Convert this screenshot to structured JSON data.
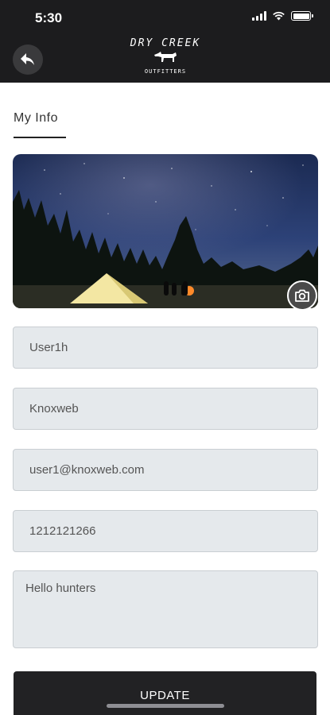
{
  "status_bar": {
    "time": "5:30"
  },
  "header": {
    "logo_top": "DRY CREEK",
    "logo_bottom": "OUTFITTERS"
  },
  "page": {
    "title": "My Info"
  },
  "form": {
    "name": "User1h",
    "company": "Knoxweb",
    "email": "user1@knoxweb.com",
    "phone": "1212121266",
    "bio": "Hello hunters"
  },
  "actions": {
    "update_label": "UPDATE"
  },
  "colors": {
    "header_bg": "#1c1c1e",
    "field_bg": "#e5e9ec",
    "button_bg": "#222224"
  },
  "icons": [
    "back-arrow-icon",
    "camera-icon",
    "wifi-icon",
    "battery-icon",
    "signal-icon"
  ]
}
